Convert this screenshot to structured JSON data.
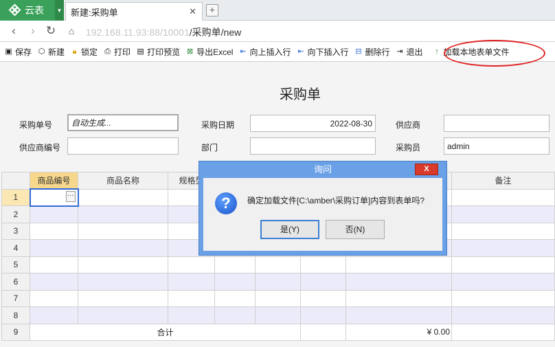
{
  "tabbar": {
    "app_name": "云表",
    "tab_title": "新建:采购单",
    "close_glyph": "✕",
    "new_tab_glyph": "+"
  },
  "address": {
    "url_blurred": "192.168.11.93:88/10001",
    "url_path": "/采购单/new"
  },
  "toolbar": {
    "items": [
      {
        "label": "保存",
        "icon": "save-icon"
      },
      {
        "label": "新建",
        "icon": "new-icon"
      },
      {
        "label": "锁定",
        "icon": "lock-icon"
      },
      {
        "label": "打印",
        "icon": "print-icon"
      },
      {
        "label": "打印预览",
        "icon": "print-preview-icon"
      },
      {
        "label": "导出Excel",
        "icon": "excel-icon"
      },
      {
        "label": "向上插入行",
        "icon": "insert-above-icon"
      },
      {
        "label": "向下插入行",
        "icon": "insert-below-icon"
      },
      {
        "label": "删除行",
        "icon": "delete-row-icon"
      },
      {
        "label": "退出",
        "icon": "exit-icon"
      },
      {
        "label": "加载本地表单文件",
        "icon": "upload-icon"
      }
    ]
  },
  "form": {
    "title": "采购单",
    "order_no_label": "采购单号",
    "order_no_value": "自动生成...",
    "date_label": "采购日期",
    "date_value": "2022-08-30",
    "supplier_label": "供应商",
    "supplier_value": "",
    "supplier_code_label": "供应商编号",
    "supplier_code_value": "",
    "dept_label": "部门",
    "dept_value": "",
    "buyer_label": "采购员",
    "buyer_value": "admin"
  },
  "grid": {
    "headers": [
      "商品编号",
      "商品名称",
      "规格型",
      "",
      "",
      "",
      "",
      "备注"
    ],
    "row_numbers": [
      "1",
      "2",
      "3",
      "4",
      "5",
      "6",
      "7",
      "8"
    ],
    "total_row_number": "9",
    "total_label": "合计",
    "total_amount": "¥ 0.00",
    "ellipsis": "···"
  },
  "dialog": {
    "title": "询问",
    "close_glyph": "X",
    "message": "确定加载文件[C:\\amber\\采购订单]内容到表单吗?",
    "yes_label": "是(Y)",
    "no_label": "否(N)",
    "icon_glyph": "?"
  },
  "colors": {
    "accent_green": "#3aa05a",
    "dialog_blue": "#6aa1e6",
    "highlight_red": "#e02020"
  }
}
